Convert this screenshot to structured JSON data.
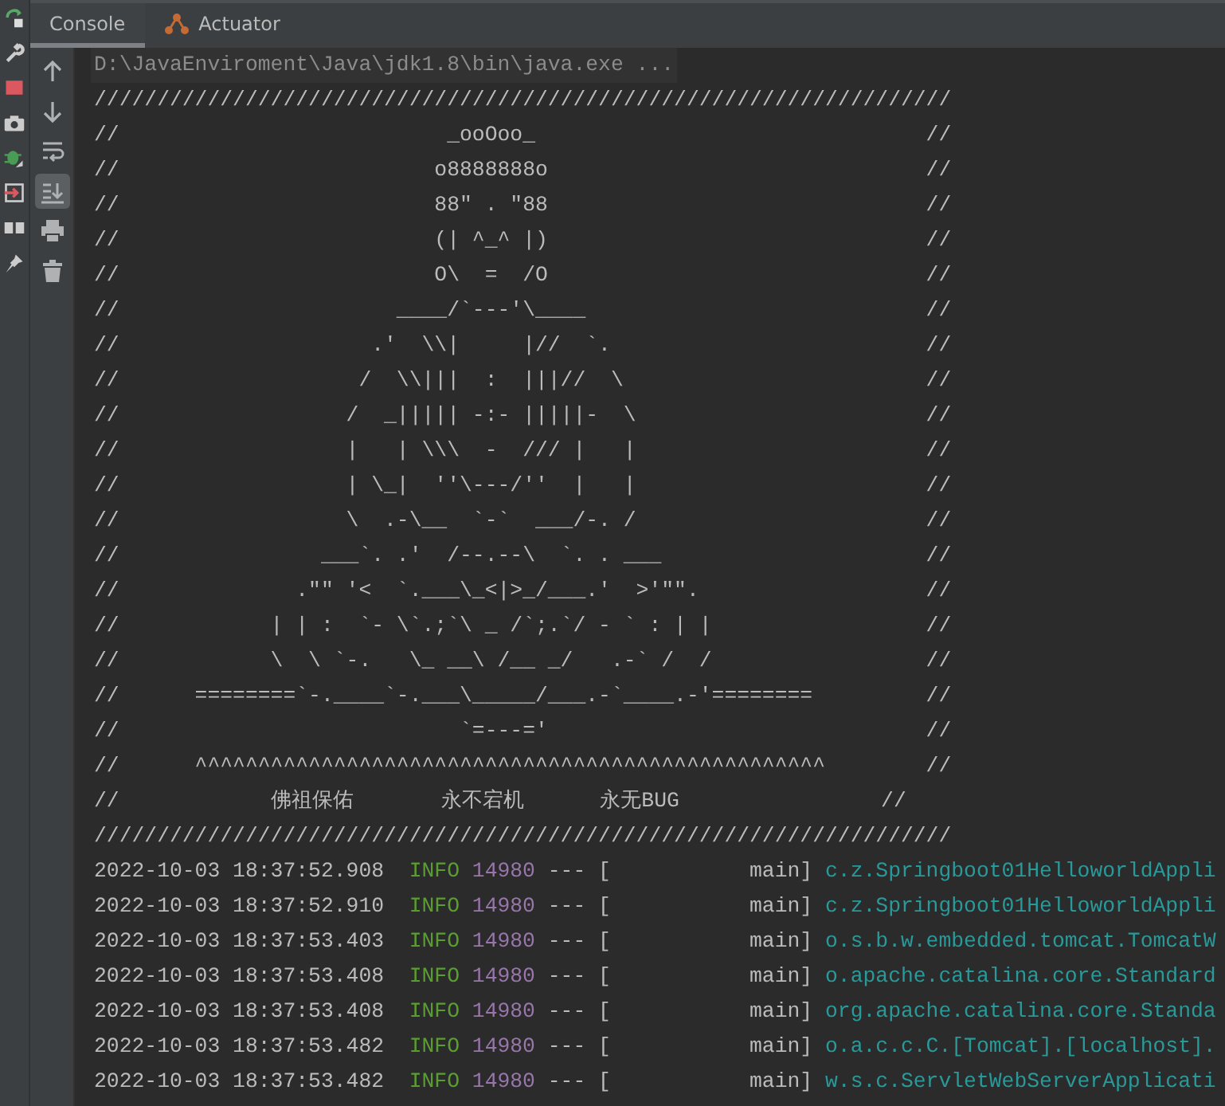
{
  "side_strip": [
    {
      "kind": "rerun"
    },
    {
      "kind": "wrench"
    },
    {
      "kind": "stop"
    },
    {
      "kind": "camera"
    },
    {
      "kind": "bug"
    },
    {
      "kind": "login"
    },
    {
      "kind": "layout"
    },
    {
      "kind": "pin"
    }
  ],
  "tabs": [
    {
      "label": "Console",
      "selected": true,
      "kind": "console"
    },
    {
      "label": "Actuator",
      "selected": false,
      "kind": "actuator"
    }
  ],
  "console_toolbar": [
    {
      "kind": "up",
      "on": false
    },
    {
      "kind": "down",
      "on": false
    },
    {
      "kind": "wrap",
      "on": false
    },
    {
      "kind": "scroll-end",
      "on": true
    },
    {
      "kind": "print",
      "on": false
    },
    {
      "kind": "trash",
      "on": false
    }
  ],
  "command_line": "D:\\JavaEnviroment\\Java\\jdk1.8\\bin\\java.exe ...",
  "banner_lines": [
    "////////////////////////////////////////////////////////////////////",
    "//                          _ooOoo_                               //",
    "//                         o8888888o                              //",
    "//                         88\" . \"88                              //",
    "//                         (| ^_^ |)                              //",
    "//                         O\\  =  /O                              //",
    "//                      ____/`---'\\____                           //",
    "//                    .'  \\\\|     |//  `.                         //",
    "//                   /  \\\\|||  :  |||//  \\                        //",
    "//                  /  _||||| -:- |||||-  \\                       //",
    "//                  |   | \\\\\\  -  /// |   |                       //",
    "//                  | \\_|  ''\\---/''  |   |                       //",
    "//                  \\  .-\\__  `-`  ___/-. /                       //",
    "//                ___`. .'  /--.--\\  `. . ___                     //",
    "//              .\"\" '<  `.___\\_<|>_/___.'  >'\"\".                  //",
    "//            | | :  `- \\`.;`\\ _ /`;.`/ - ` : | |                 //",
    "//            \\  \\ `-.   \\_ __\\ /__ _/   .-` /  /                 //",
    "//      ========`-.____`-.___\\_____/___.-`____.-'========         //",
    "//                           `=---='                              //",
    "//      ^^^^^^^^^^^^^^^^^^^^^^^^^^^^^^^^^^^^^^^^^^^^^^^^^^        //",
    "//            佛祖保佑       永不宕机      永无BUG                //",
    "////////////////////////////////////////////////////////////////////"
  ],
  "log_rows": [
    {
      "timestamp": "2022-10-03 18:37:52.908",
      "level": "INFO",
      "pid": "14980",
      "separator": "---",
      "thread": "[           main]",
      "logger": "c.z.Springboot01HelloworldAppli"
    },
    {
      "timestamp": "2022-10-03 18:37:52.910",
      "level": "INFO",
      "pid": "14980",
      "separator": "---",
      "thread": "[           main]",
      "logger": "c.z.Springboot01HelloworldAppli"
    },
    {
      "timestamp": "2022-10-03 18:37:53.403",
      "level": "INFO",
      "pid": "14980",
      "separator": "---",
      "thread": "[           main]",
      "logger": "o.s.b.w.embedded.tomcat.TomcatW"
    },
    {
      "timestamp": "2022-10-03 18:37:53.408",
      "level": "INFO",
      "pid": "14980",
      "separator": "---",
      "thread": "[           main]",
      "logger": "o.apache.catalina.core.Standard"
    },
    {
      "timestamp": "2022-10-03 18:37:53.408",
      "level": "INFO",
      "pid": "14980",
      "separator": "---",
      "thread": "[           main]",
      "logger": "org.apache.catalina.core.Standa"
    },
    {
      "timestamp": "2022-10-03 18:37:53.482",
      "level": "INFO",
      "pid": "14980",
      "separator": "---",
      "thread": "[           main]",
      "logger": "o.a.c.c.C.[Tomcat].[localhost]."
    },
    {
      "timestamp": "2022-10-03 18:37:53.482",
      "level": "INFO",
      "pid": "14980",
      "separator": "---",
      "thread": "[           main]",
      "logger": "w.s.c.ServletWebServerApplicati"
    }
  ]
}
